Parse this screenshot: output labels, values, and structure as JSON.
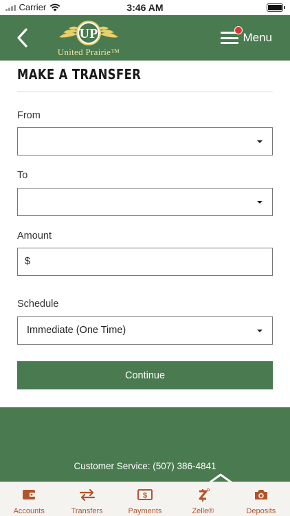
{
  "status_bar": {
    "carrier": "Carrier",
    "time": "3:46 AM",
    "battery_level": 1.0
  },
  "header": {
    "back_icon": "chevron-left-icon",
    "logo_text": "United Prairie™",
    "logo_monogram": "UP",
    "menu_label": "Menu",
    "menu_has_notification": true
  },
  "transfer_form": {
    "title": "MAKE A TRANSFER",
    "from_label": "From",
    "from_value": "",
    "to_label": "To",
    "to_value": "",
    "amount_label": "Amount",
    "amount_prefix": "$",
    "amount_value": "",
    "schedule_label": "Schedule",
    "schedule_value": "Immediate (One Time)",
    "continue_label": "Continue"
  },
  "footer": {
    "customer_service": "Customer Service: (507) 386-4841"
  },
  "tab_bar": {
    "tabs": [
      {
        "label": "Accounts",
        "icon": "wallet-icon"
      },
      {
        "label": "Transfers",
        "icon": "arrows-swap-icon"
      },
      {
        "label": "Payments",
        "icon": "dollar-bill-icon"
      },
      {
        "label": "Zelle®",
        "icon": "zelle-icon"
      },
      {
        "label": "Deposits",
        "icon": "camera-icon"
      }
    ]
  },
  "colors": {
    "brand_green": "#4a7a4f",
    "tab_accent": "#b0552a",
    "logo_gold": "#f3e3a0",
    "notification_red": "#e03333"
  }
}
